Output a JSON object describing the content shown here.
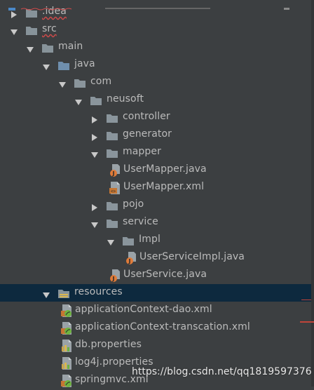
{
  "tree": [
    {
      "label": ".idea",
      "depth": 0,
      "type": "folder",
      "arrow": "right",
      "icon": "folder-icon",
      "underline": true
    },
    {
      "label": "src",
      "depth": 0,
      "type": "folder",
      "arrow": "down",
      "icon": "folder-icon",
      "underline": true
    },
    {
      "label": "main",
      "depth": 1,
      "type": "folder",
      "arrow": "down",
      "icon": "folder-icon"
    },
    {
      "label": "java",
      "depth": 2,
      "type": "folder",
      "arrow": "down",
      "icon": "source-folder-icon"
    },
    {
      "label": "com",
      "depth": 3,
      "type": "folder",
      "arrow": "down",
      "icon": "package-icon"
    },
    {
      "label": "neusoft",
      "depth": 4,
      "type": "folder",
      "arrow": "down",
      "icon": "package-icon"
    },
    {
      "label": "controller",
      "depth": 5,
      "type": "folder",
      "arrow": "right",
      "icon": "package-icon"
    },
    {
      "label": "generator",
      "depth": 5,
      "type": "folder",
      "arrow": "right",
      "icon": "package-icon"
    },
    {
      "label": "mapper",
      "depth": 5,
      "type": "folder",
      "arrow": "down",
      "icon": "package-icon"
    },
    {
      "label": "UserMapper.java",
      "depth": 6,
      "type": "java",
      "icon": "java-interface-icon"
    },
    {
      "label": "UserMapper.xml",
      "depth": 6,
      "type": "xml",
      "icon": "xml-file-icon"
    },
    {
      "label": "pojo",
      "depth": 5,
      "type": "folder",
      "arrow": "right",
      "icon": "package-icon"
    },
    {
      "label": "service",
      "depth": 5,
      "type": "folder",
      "arrow": "down",
      "icon": "package-icon"
    },
    {
      "label": "Impl",
      "depth": 6,
      "type": "folder",
      "arrow": "down",
      "icon": "package-icon"
    },
    {
      "label": "UserServiceImpl.java",
      "depth": 7,
      "type": "java",
      "icon": "java-class-icon"
    },
    {
      "label": "UserService.java",
      "depth": 6,
      "type": "java",
      "icon": "java-interface-icon"
    },
    {
      "label": "resources",
      "depth": 2,
      "type": "folder",
      "arrow": "down",
      "icon": "resources-folder-icon",
      "selected": true
    },
    {
      "label": "applicationContext-dao.xml",
      "depth": 3,
      "type": "spring",
      "icon": "spring-xml-icon"
    },
    {
      "label": "applicationContext-transcation.xml",
      "depth": 3,
      "type": "spring",
      "icon": "spring-xml-icon"
    },
    {
      "label": "db.properties",
      "depth": 3,
      "type": "props",
      "icon": "properties-file-icon"
    },
    {
      "label": "log4j.properties",
      "depth": 3,
      "type": "props",
      "icon": "properties-file-icon"
    },
    {
      "label": "springmvc.xml",
      "depth": 3,
      "type": "spring",
      "icon": "spring-xml-icon"
    }
  ],
  "watermark": "https://blog.csdn.net/qq1819597376",
  "colors": {
    "background": "#3c3f41",
    "selection": "#0d293e",
    "text": "#bbbbbb",
    "folder": "#87939a",
    "java_badge": "#e07b39",
    "xml_badge": "#c57633",
    "spring_leaf": "#6db33f",
    "error_underline": "#d04a4a"
  }
}
